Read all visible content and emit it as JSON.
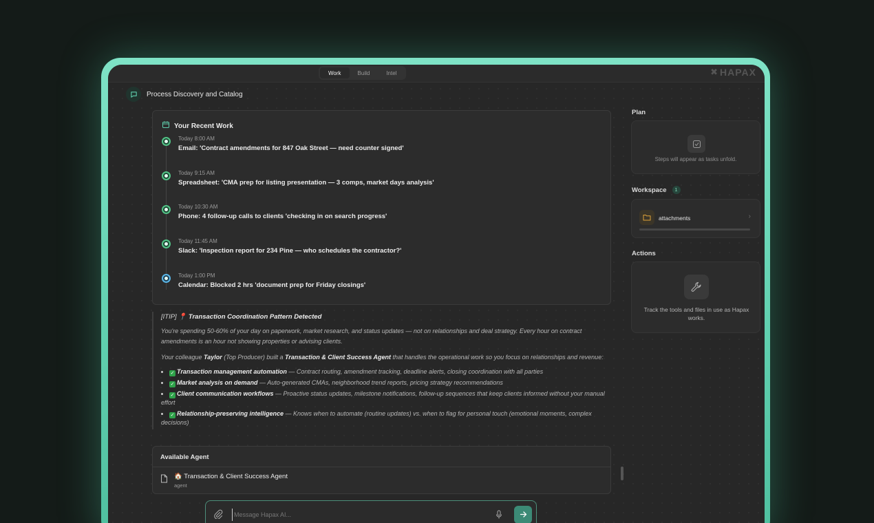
{
  "tabs": [
    {
      "label": "Work",
      "active": true
    },
    {
      "label": "Build",
      "active": false
    },
    {
      "label": "Intel",
      "active": false
    }
  ],
  "brand": "HAPAX",
  "conversation_title": "Process Discovery and Catalog",
  "recent_work": {
    "title": "Your Recent Work",
    "items": [
      {
        "time": "Today 8:00 AM",
        "text": "Email: 'Contract amendments for 847 Oak Street — need counter signed'"
      },
      {
        "time": "Today 9:15 AM",
        "text": "Spreadsheet: 'CMA prep for listing presentation — 3 comps, market days analysis'"
      },
      {
        "time": "Today 10:30 AM",
        "text": "Phone: 4 follow-up calls to clients 'checking in on search progress'"
      },
      {
        "time": "Today 11:45 AM",
        "text": "Slack: 'Inspection report for 234 Pine — who schedules the contractor?'"
      },
      {
        "time": "Today 1:00 PM",
        "text": "Calendar: Blocked 2 hrs 'document prep for Friday closings'"
      }
    ]
  },
  "tip": {
    "prefix": "[ITIP]",
    "pin_glyph": "📍",
    "title": "Transaction Coordination Pattern Detected",
    "paragraph1": "You're spending 50-60% of your day on paperwork, market research, and status updates — not on relationships and deal strategy. Every hour on contract amendments is an hour not showing properties or advising clients.",
    "p2_a": "Your colleague ",
    "p2_name": "Taylor",
    "p2_b": " (Top Producer) built a ",
    "p2_agent": "Transaction & Client Success Agent",
    "p2_c": " that handles the operational work so you focus on relationships and revenue:",
    "check_glyph": "✓",
    "bullets": [
      {
        "title": "Transaction management automation",
        "desc": " — Contract routing, amendment tracking, deadline alerts, closing coordination with all parties"
      },
      {
        "title": "Market analysis on demand",
        "desc": " — Auto-generated CMAs, neighborhood trend reports, pricing strategy recommendations"
      },
      {
        "title": "Client communication workflows",
        "desc": " — Proactive status updates, milestone notifications, follow-up sequences that keep clients informed without your manual effort"
      },
      {
        "title": "Relationship-preserving intelligence",
        "desc": " — Knows when to automate (routine updates) vs. when to flag for personal touch (emotional moments, complex decisions)"
      }
    ]
  },
  "available_agent": {
    "heading": "Available Agent",
    "name": "🏠 Transaction & Client Success Agent",
    "type": "agent"
  },
  "composer": {
    "placeholder": "Message Hapax AI...",
    "value": ""
  },
  "sidebar": {
    "plan_label": "Plan",
    "plan_empty": "Steps will appear as tasks unfold.",
    "workspace_label": "Workspace",
    "workspace_count": "1",
    "workspace_item": "attachments",
    "actions_label": "Actions",
    "actions_empty": "Track the tools and files in use as Hapax works."
  },
  "colors": {
    "accent": "#5fcfae",
    "done_dot": "#52c487",
    "current_dot": "#5bb7e8",
    "send_button": "#3c8a76"
  }
}
